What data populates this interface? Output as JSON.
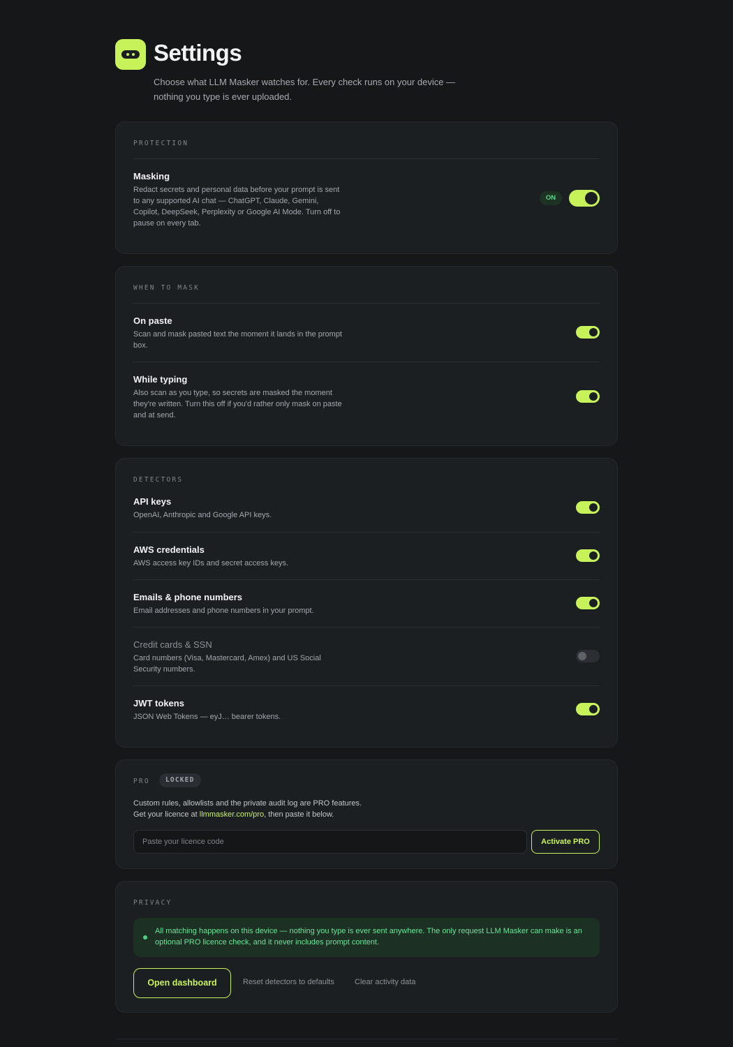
{
  "header": {
    "title": "Settings",
    "subtitle": "Choose what LLM Masker watches for. Every check runs on your device — nothing you type is ever uploaded."
  },
  "protection": {
    "label": "PROTECTION",
    "masking": {
      "title": "Masking",
      "desc": "Redact secrets and personal data before your prompt is sent to any supported AI chat — ChatGPT, Claude, Gemini, Copilot, DeepSeek, Perplexity or Google AI Mode. Turn off to pause on every tab.",
      "status": "ON",
      "enabled": true
    }
  },
  "when_to_mask": {
    "label": "WHEN TO MASK",
    "items": [
      {
        "title": "On paste",
        "desc": "Scan and mask pasted text the moment it lands in the prompt box.",
        "enabled": true
      },
      {
        "title": "While typing",
        "desc": "Also scan as you type, so secrets are masked the moment they're written. Turn this off if you'd rather only mask on paste and at send.",
        "enabled": true
      }
    ]
  },
  "detectors": {
    "label": "DETECTORS",
    "items": [
      {
        "title": "API keys",
        "desc": "OpenAI, Anthropic and Google API keys.",
        "enabled": true
      },
      {
        "title": "AWS credentials",
        "desc": "AWS access key IDs and secret access keys.",
        "enabled": true
      },
      {
        "title": "Emails & phone numbers",
        "desc": "Email addresses and phone numbers in your prompt.",
        "enabled": true
      },
      {
        "title": "Credit cards & SSN",
        "desc": "Card numbers (Visa, Mastercard, Amex) and US Social Security numbers.",
        "enabled": false
      },
      {
        "title": "JWT tokens",
        "desc": "JSON Web Tokens — eyJ… bearer tokens.",
        "enabled": true
      }
    ]
  },
  "pro": {
    "label": "PRO",
    "badge": "LOCKED",
    "text_line1": "Custom rules, allowlists and the private audit log are PRO features.",
    "text_line2_prefix": "Get your licence at ",
    "link": "llmmasker.com/pro",
    "text_line2_suffix": ", then paste it below.",
    "input_placeholder": "Paste your licence code",
    "input_value": "",
    "activate_label": "Activate PRO"
  },
  "privacy": {
    "label": "PRIVACY",
    "note": "All matching happens on this device — nothing you type is ever sent anywhere. The only request LLM Masker can make is an optional PRO licence check, and it never includes prompt content.",
    "dashboard_label": "Open dashboard",
    "reset_label": "Reset detectors to defaults",
    "clear_label": "Clear activity data"
  },
  "colors": {
    "accent": "#c8f25a",
    "background": "#151719",
    "card": "#1c1f22",
    "success": "#5fd68a"
  }
}
